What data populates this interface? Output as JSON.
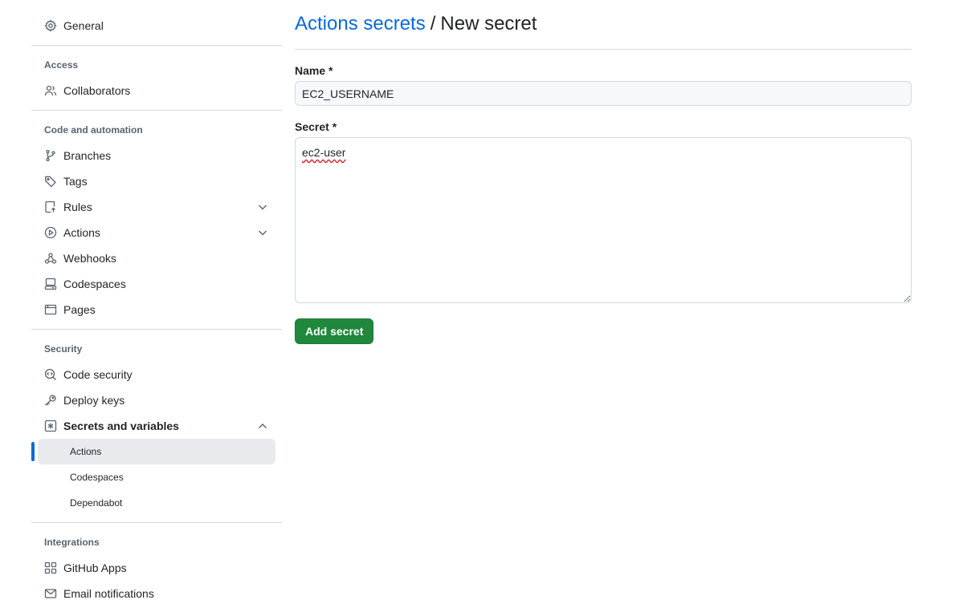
{
  "sidebar": {
    "general": "General",
    "sections": [
      {
        "title": "Access",
        "items": [
          {
            "label": "Collaborators"
          }
        ]
      },
      {
        "title": "Code and automation",
        "items": [
          {
            "label": "Branches"
          },
          {
            "label": "Tags"
          },
          {
            "label": "Rules"
          },
          {
            "label": "Actions"
          },
          {
            "label": "Webhooks"
          },
          {
            "label": "Codespaces"
          },
          {
            "label": "Pages"
          }
        ]
      },
      {
        "title": "Security",
        "items": [
          {
            "label": "Code security"
          },
          {
            "label": "Deploy keys"
          },
          {
            "label": "Secrets and variables"
          }
        ]
      },
      {
        "title": "Integrations",
        "items": [
          {
            "label": "GitHub Apps"
          },
          {
            "label": "Email notifications"
          }
        ]
      }
    ],
    "secrets_sub": [
      "Actions",
      "Codespaces",
      "Dependabot"
    ]
  },
  "header": {
    "breadcrumb_link": "Actions secrets",
    "separator": "/",
    "current": "New secret"
  },
  "form": {
    "name_label": "Name *",
    "name_value": "EC2_USERNAME",
    "secret_label": "Secret *",
    "secret_value": "ec2-user",
    "submit_label": "Add secret"
  },
  "colors": {
    "accent": "#0969da",
    "primary_button": "#1f883d"
  }
}
